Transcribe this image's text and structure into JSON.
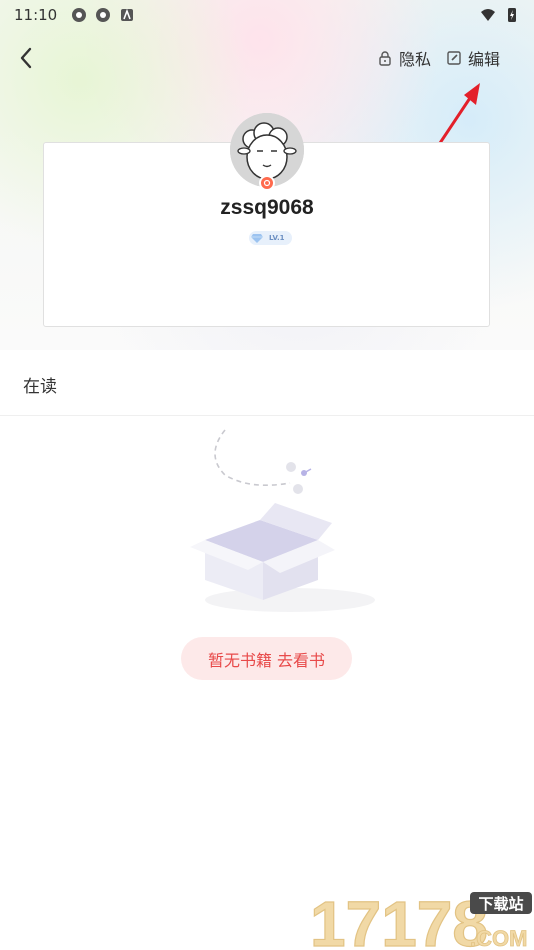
{
  "status_bar": {
    "time": "11:10"
  },
  "header": {
    "privacy_label": "隐私",
    "edit_label": "编辑"
  },
  "profile": {
    "username": "zssq9068",
    "level": "LV.1"
  },
  "reading": {
    "section_title": "在读",
    "empty_cta": "暂无书籍 去看书"
  },
  "watermark": {
    "digits": "17178",
    "site_tag": "下载站",
    "domain": ".COM"
  },
  "colors": {
    "accent_red": "#e84a4a",
    "cta_bg": "#fde9e9",
    "annotation_arrow": "#e3202a"
  }
}
